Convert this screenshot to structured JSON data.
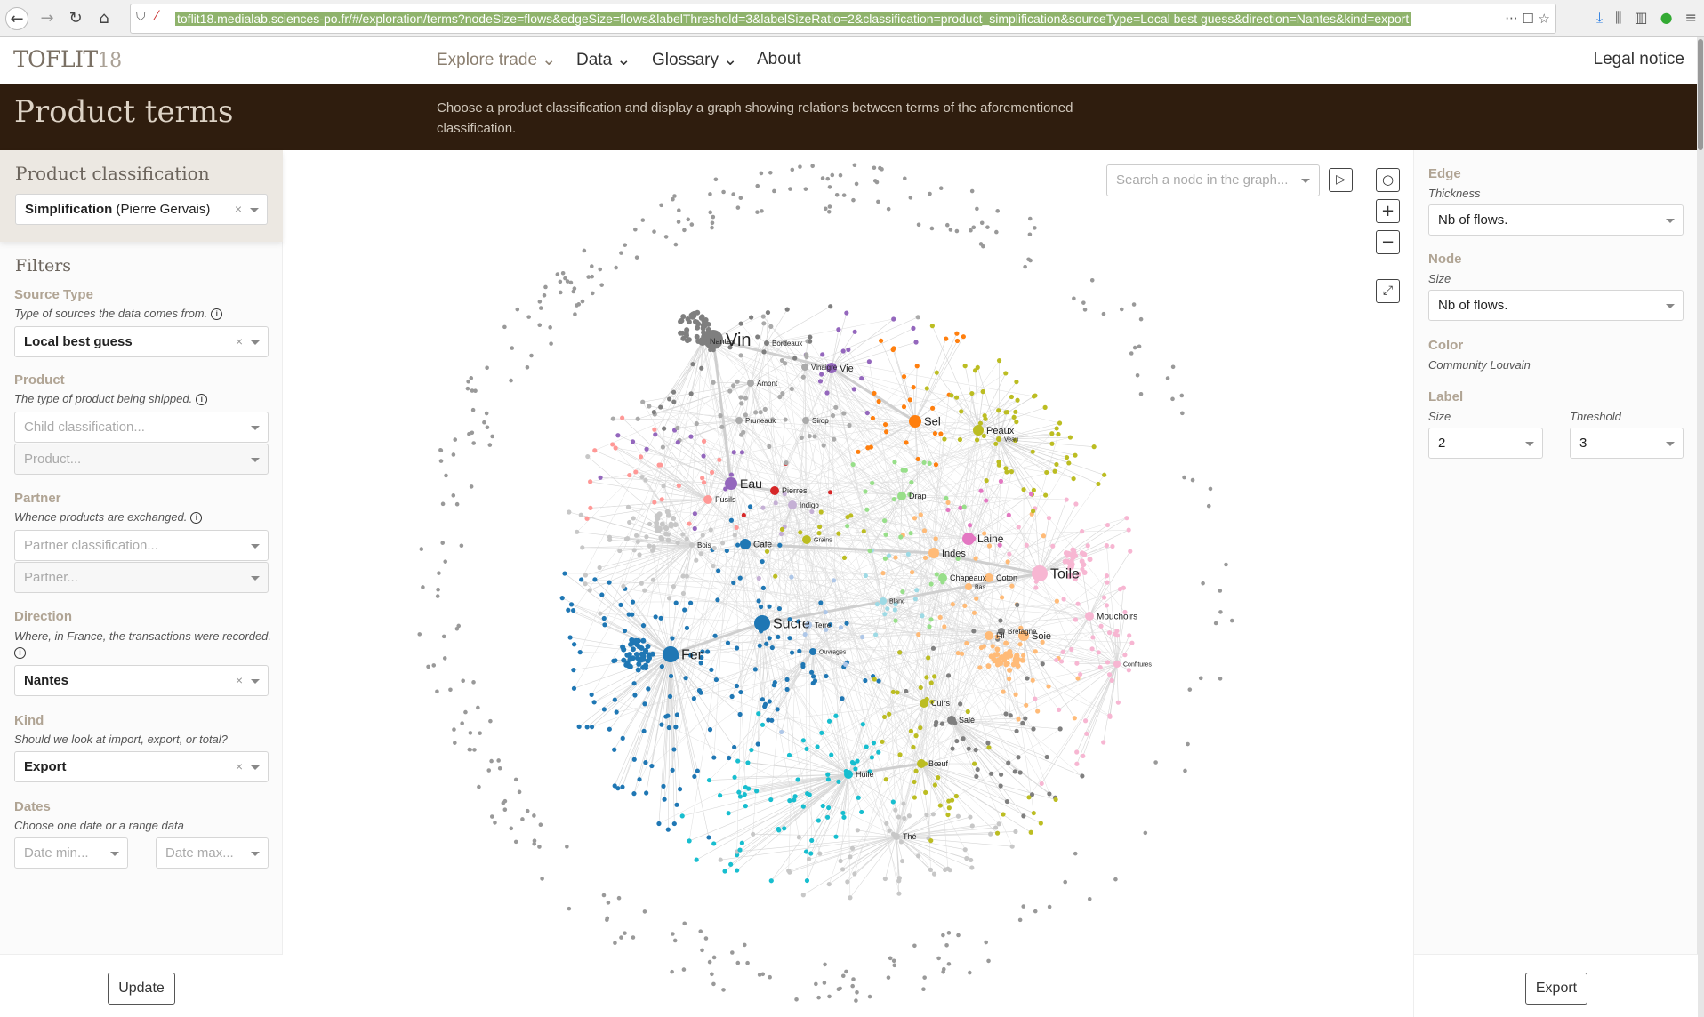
{
  "browser": {
    "url": "toflit18.medialab.sciences-po.fr/#/exploration/terms?nodeSize=flows&edgeSize=flows&labelThreshold=3&labelSizeRatio=2&classification=product_simplification&sourceType=Local best guess&direction=Nantes&kind=export"
  },
  "nav": {
    "logo_main": "TOFLIT",
    "logo_suffix": "18",
    "items": [
      {
        "label": "Explore trade",
        "active": true
      },
      {
        "label": "Data"
      },
      {
        "label": "Glossary"
      },
      {
        "label": "About"
      }
    ],
    "legal": "Legal notice"
  },
  "header": {
    "title": "Product terms",
    "description": "Choose a product classification and display a graph showing relations between terms of the aforementioned classification."
  },
  "left": {
    "classification_title": "Product classification",
    "classification_bold": "Simplification",
    "classification_rest": " (Pierre Gervais)",
    "filters_title": "Filters",
    "source_type": {
      "label": "Source Type",
      "desc": "Type of sources the data comes from.",
      "value": "Local best guess"
    },
    "product": {
      "label": "Product",
      "desc": "The type of product being shipped.",
      "child_placeholder": "Child classification...",
      "product_placeholder": "Product..."
    },
    "partner": {
      "label": "Partner",
      "desc": "Whence products are exchanged.",
      "class_placeholder": "Partner classification...",
      "partner_placeholder": "Partner..."
    },
    "direction": {
      "label": "Direction",
      "desc": "Where, in France, the transactions were recorded.",
      "value": "Nantes"
    },
    "kind": {
      "label": "Kind",
      "desc": "Should we look at import, export, or total?",
      "value": "Export"
    },
    "dates": {
      "label": "Dates",
      "desc": "Choose one date or a range data",
      "min_placeholder": "Date min...",
      "max_placeholder": "Date max..."
    },
    "update": "Update"
  },
  "graph": {
    "search_placeholder": "Search a node in the graph...",
    "nodes": [
      {
        "label": "Vin",
        "color": "#7f7f7f"
      },
      {
        "label": "Nantes",
        "color": "#7f7f7f"
      },
      {
        "label": "Bordeaux",
        "color": "#7f7f7f"
      },
      {
        "label": "Vinaigre",
        "color": "#aaaaaa"
      },
      {
        "label": "Vie",
        "color": "#9467bd"
      },
      {
        "label": "Amont",
        "color": "#aaaaaa"
      },
      {
        "label": "Sel",
        "color": "#ff7f0e"
      },
      {
        "label": "Pruneaux",
        "color": "#aaaaaa"
      },
      {
        "label": "Sirop",
        "color": "#aaaaaa"
      },
      {
        "label": "Peaux",
        "color": "#bcbd22"
      },
      {
        "label": "Veau",
        "color": "#bcbd22"
      },
      {
        "label": "Eau",
        "color": "#9467bd"
      },
      {
        "label": "Pierres",
        "color": "#d62728"
      },
      {
        "label": "Fusils",
        "color": "#ff9896"
      },
      {
        "label": "Indigo",
        "color": "#c5b0d5"
      },
      {
        "label": "Drap",
        "color": "#98df8a"
      },
      {
        "label": "Laine",
        "color": "#e377c2"
      },
      {
        "label": "Bois",
        "color": "#c7c7c7"
      },
      {
        "label": "Café",
        "color": "#1f77b4"
      },
      {
        "label": "Grains",
        "color": "#bcbd22"
      },
      {
        "label": "Indes",
        "color": "#ffbb78"
      },
      {
        "label": "Toile",
        "color": "#f7b6d2"
      },
      {
        "label": "Chapeaux",
        "color": "#98df8a"
      },
      {
        "label": "Coton",
        "color": "#ffbb78"
      },
      {
        "label": "Bas",
        "color": "#ffbb78"
      },
      {
        "label": "Blanc",
        "color": "#9edae5"
      },
      {
        "label": "Sucre",
        "color": "#1f77b4"
      },
      {
        "label": "Terre",
        "color": "#aec7e8"
      },
      {
        "label": "Mouchoirs",
        "color": "#f7b6d2"
      },
      {
        "label": "Bretagne",
        "color": "#7f7f7f"
      },
      {
        "label": "Fil",
        "color": "#ffbb78"
      },
      {
        "label": "Soie",
        "color": "#ffbb78"
      },
      {
        "label": "Fer",
        "color": "#1f77b4"
      },
      {
        "label": "Ouvrages",
        "color": "#1f77b4"
      },
      {
        "label": "Confitures",
        "color": "#f7b6d2"
      },
      {
        "label": "Cuirs",
        "color": "#bcbd22"
      },
      {
        "label": "Salé",
        "color": "#7f7f7f"
      },
      {
        "label": "Bœuf",
        "color": "#bcbd22"
      },
      {
        "label": "Huile",
        "color": "#17becf"
      },
      {
        "label": "Thé",
        "color": "#c7c7c7"
      }
    ]
  },
  "right": {
    "edge": {
      "title": "Edge",
      "thickness_label": "Thickness",
      "thickness_value": "Nb of flows."
    },
    "node": {
      "title": "Node",
      "size_label": "Size",
      "size_value": "Nb of flows."
    },
    "color": {
      "title": "Color",
      "value": "Community Louvain"
    },
    "label": {
      "title": "Label",
      "size_label": "Size",
      "size_value": "2",
      "threshold_label": "Threshold",
      "threshold_value": "3"
    },
    "export": "Export"
  }
}
